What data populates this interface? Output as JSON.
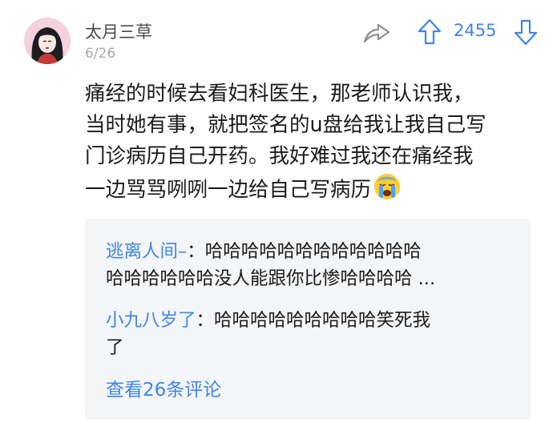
{
  "post": {
    "username": "太月三草",
    "date": "6/26",
    "vote_count": "2455",
    "content_lines": [
      "痛经的时候去看妇科医生，那老师认识我，",
      "当时她有事，就把签名的u盘给我让我自己写",
      "门诊病历自己开药。我好难过我还在痛经我",
      "一边骂骂咧咧一边给自己写病历"
    ],
    "emoji": "crying-face-emoji"
  },
  "comments": [
    {
      "author": "逃离人间–",
      "separator": "：",
      "line1": "哈哈哈哈哈哈哈哈哈哈哈哈",
      "line2": "哈哈哈哈哈哈没人能跟你比惨哈哈哈哈 ..."
    },
    {
      "author": "小九八岁了",
      "separator": "：",
      "line1": "哈哈哈哈哈哈哈哈哈笑死我",
      "line2": "了"
    }
  ],
  "view_all_label": "查看26条评论",
  "colors": {
    "accent": "#3e86e6",
    "text": "#1a1a1a",
    "muted": "#a8a8a8",
    "comment_bg": "#f4f5f7"
  },
  "icons": {
    "share": "share-arrow-icon",
    "upvote": "upvote-arrow-icon",
    "downvote": "downvote-arrow-icon"
  }
}
